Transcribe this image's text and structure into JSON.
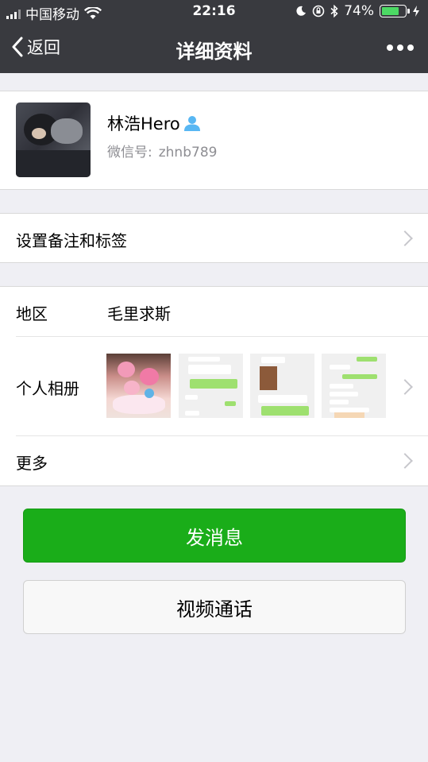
{
  "status_bar": {
    "carrier": "中国移动",
    "time": "22:16",
    "battery_percent": "74%",
    "battery_level": 0.74,
    "icons": [
      "signal-icon",
      "wifi-icon",
      "moon-icon",
      "orientation-lock-icon",
      "bluetooth-icon",
      "battery-icon",
      "charging-icon"
    ]
  },
  "nav": {
    "back_label": "返回",
    "title": "详细资料",
    "more_icon": "more-icon"
  },
  "profile": {
    "name": "林浩Hero",
    "gender_icon": "male-icon",
    "wxid_label": "微信号:",
    "wxid_value": "zhnb789"
  },
  "remark": {
    "label": "设置备注和标签"
  },
  "info": {
    "region_label": "地区",
    "region_value": "毛里求斯",
    "album_label": "个人相册",
    "more_label": "更多"
  },
  "actions": {
    "message_label": "发消息",
    "video_call_label": "视频通话"
  },
  "colors": {
    "nav_bg": "#393a3f",
    "page_bg": "#efeff4",
    "primary_green": "#1aad19",
    "battery_green": "#4cd964",
    "gender_blue": "#58b7f3"
  }
}
